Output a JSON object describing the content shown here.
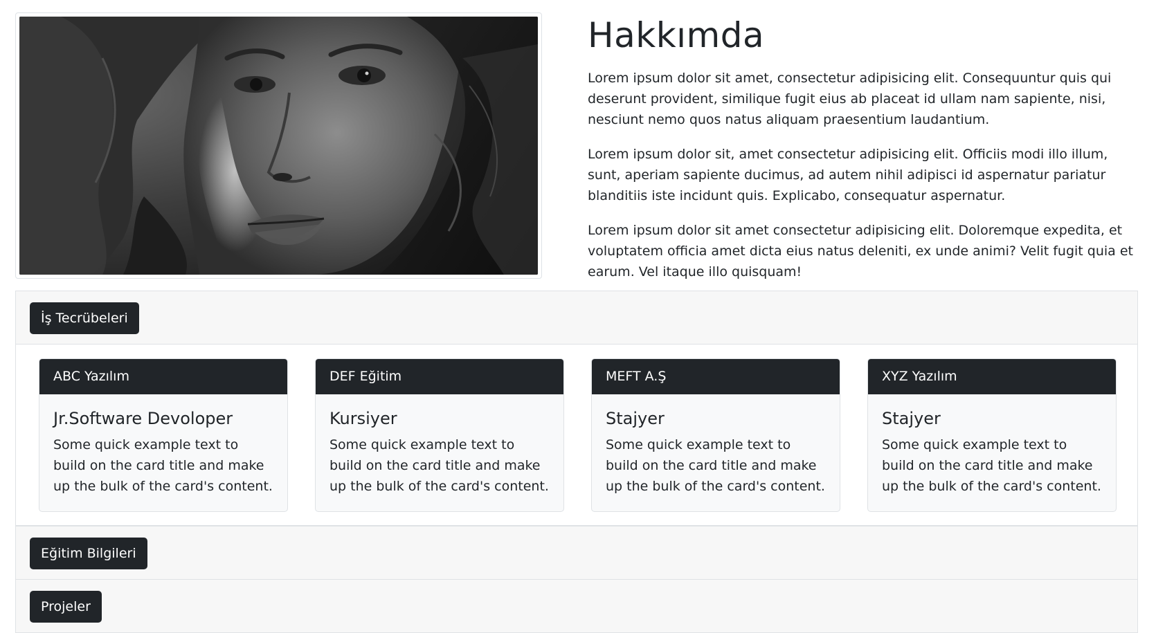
{
  "about": {
    "title": "Hakkımda",
    "paragraphs": [
      "Lorem ipsum dolor sit amet, consectetur adipisicing elit. Consequuntur quis qui deserunt provident, similique fugit eius ab placeat id ullam nam sapiente, nisi, nesciunt nemo quos natus aliquam praesentium laudantium.",
      "Lorem ipsum dolor sit, amet consectetur adipisicing elit. Officiis modi illo illum, sunt, aperiam sapiente ducimus, ad autem nihil adipisci id aspernatur pariatur blanditiis iste incidunt quis. Explicabo, consequatur aspernatur.",
      "Lorem ipsum dolor sit amet consectetur adipisicing elit. Doloremque expedita, et voluptatem officia amet dicta eius natus deleniti, ex unde animi? Velit fugit quia et earum. Vel itaque illo quisquam!"
    ]
  },
  "accordion": {
    "experience_button": "İş Tecrübeleri",
    "education_button": "Eğitim Bilgileri",
    "projects_button": "Projeler"
  },
  "cards": [
    {
      "company": "ABC Yazılım",
      "title": "Jr.Software Devoloper",
      "text": "Some quick example text to build on the card title and make up the bulk of the card's content."
    },
    {
      "company": "DEF Eğitim",
      "title": "Kursiyer",
      "text": "Some quick example text to build on the card title and make up the bulk of the card's content."
    },
    {
      "company": "MEFT A.Ş",
      "title": "Stajyer",
      "text": "Some quick example text to build on the card title and make up the bulk of the card's content."
    },
    {
      "company": "XYZ Yazılım",
      "title": "Stajyer",
      "text": "Some quick example text to build on the card title and make up the bulk of the card's content."
    }
  ],
  "colors": {
    "dark": "#212529",
    "accordion_bg": "#f7f7f7",
    "card_bg": "#f8f9fa",
    "border": "#dfe2e5"
  }
}
